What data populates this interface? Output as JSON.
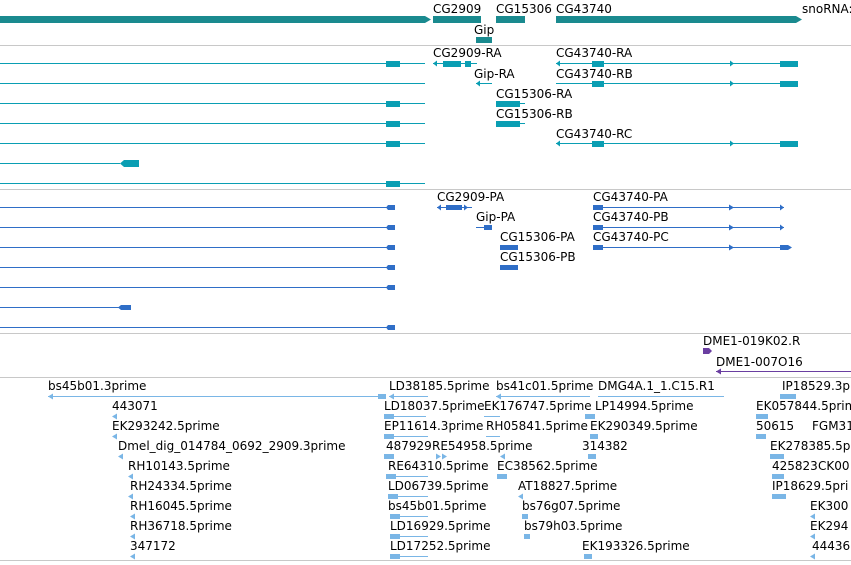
{
  "colors": {
    "gene": "#1a8a8f",
    "transcript": "#0a9eb3",
    "protein": "#2f6ec7",
    "rna_mod": "#6a3ea1",
    "est": "#7ab6e6",
    "divider": "#c8c8c8",
    "background": "#ffffff"
  },
  "gene_labels": [
    "CG2909",
    "CG15306",
    "CG43740",
    "snoRNA:",
    "Gip"
  ],
  "transcript_labels": [
    "CG2909-RA",
    "CG43740-RA",
    "Gip-RA",
    "CG43740-RB",
    "CG15306-RA",
    "CG15306-RB",
    "CG43740-RC"
  ],
  "protein_labels": [
    "CG2909-PA",
    "CG43740-PA",
    "Gip-PA",
    "CG43740-PB",
    "CG15306-PA",
    "CG43740-PC",
    "CG15306-PB"
  ],
  "rnamod_labels": [
    "DME1-019K02.R",
    "DME1-007O16"
  ],
  "est_labels": [
    "bs45b01.3prime",
    "LD38185.5prime",
    "bs41c01.5prime",
    "DMG4A.1_1.C15.R1",
    "IP18529.3p",
    "443071",
    "LD18037.5prime",
    "EK176747.5prime",
    "LP14994.5prime",
    "EK057844.5prime",
    "EK293242.5prime",
    "EP11614.3prime",
    "RH05841.5prime",
    "EK290349.5prime",
    "50615",
    "FGM31",
    "Dmel_dig_014784_0692_2909.3prime",
    "487929",
    "RE54958.5prime",
    "314382",
    "EK278385.5p",
    "RH10143.5prime",
    "RE64310.5prime",
    "EC38562.5prime",
    "425823",
    "CK00",
    "RH24334.5prime",
    "LD06739.5prime",
    "AT18827.5prime",
    "IP18629.5pri",
    "RH16045.5prime",
    "bs45b01.5prime",
    "bs76g07.5prime",
    "EK300",
    "RH36718.5prime",
    "LD16929.5prime",
    "bs79h03.5prime",
    "EK294",
    "347172",
    "LD17252.5prime",
    "EK193326.5prime",
    "44436"
  ]
}
